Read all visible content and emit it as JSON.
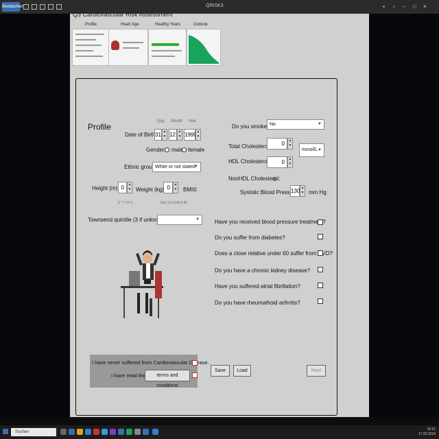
{
  "window": {
    "top_button": "Beobachten",
    "title": "QRISK3",
    "app_title": "Q3 Cardiovascular Risk Assessment"
  },
  "nav": {
    "tabs": [
      "Profile",
      "Heart Age",
      "Healthy Years",
      "Outlook"
    ]
  },
  "form": {
    "heading": "Profile",
    "dob": {
      "label": "Date of Birth",
      "day_label": "Day",
      "month_label": "Month",
      "year_label": "Year",
      "day": "31",
      "month": "12",
      "year": "1990"
    },
    "gender": {
      "label": "Gender:",
      "male": "male",
      "female": "female"
    },
    "ethnic": {
      "label": "Ethnic group",
      "value": "White or not stated"
    },
    "height": {
      "label": "Height (m):",
      "value": "0",
      "hint": "5' 7\" 67.0"
    },
    "weight": {
      "label": "Weight (kg):",
      "value": "0",
      "hint": "10st 3.0 (143.0 lb)"
    },
    "bmi": {
      "label": "BMI:",
      "value": "0"
    },
    "townsend": {
      "label": "Townsend quintile (3 if unknown):",
      "value": ""
    },
    "smoke": {
      "label": "Do you smoke?",
      "value": "No"
    },
    "total_chol": {
      "label": "Total Cholesterol:",
      "value": "0",
      "unit": "mmol/L"
    },
    "hdl": {
      "label": "HDL Cholesterol:",
      "value": "0"
    },
    "nonhdl": {
      "label": "NonHDL Cholesterol:",
      "value": "0"
    },
    "sbp": {
      "label": "Systolic Blood Pressure:",
      "value": "130",
      "unit": "mm Hg"
    },
    "questions": [
      "Have you received blood pressure treatment?",
      "Do you suffer from diabetes?",
      "Does a close relative under 60 suffer from CVD?",
      "Do you have a chronic kidney disease?",
      "Have you suffered atrial fibrillation?",
      "Do you have rheumathoid arthritis?"
    ],
    "consent": {
      "never_suffered": "I have never suffered from Cardiovascular Disease.",
      "read_the": "I have read the",
      "terms": "terms and conditions"
    },
    "buttons": {
      "save": "Save",
      "load": "Load",
      "next": "Next"
    }
  },
  "taskbar": {
    "search": "Suchen",
    "time": "16:51",
    "date": "17.02.2024"
  },
  "colors": {
    "outlook_green": "#1aa35a",
    "accent_blue": "#3a6fb0"
  }
}
